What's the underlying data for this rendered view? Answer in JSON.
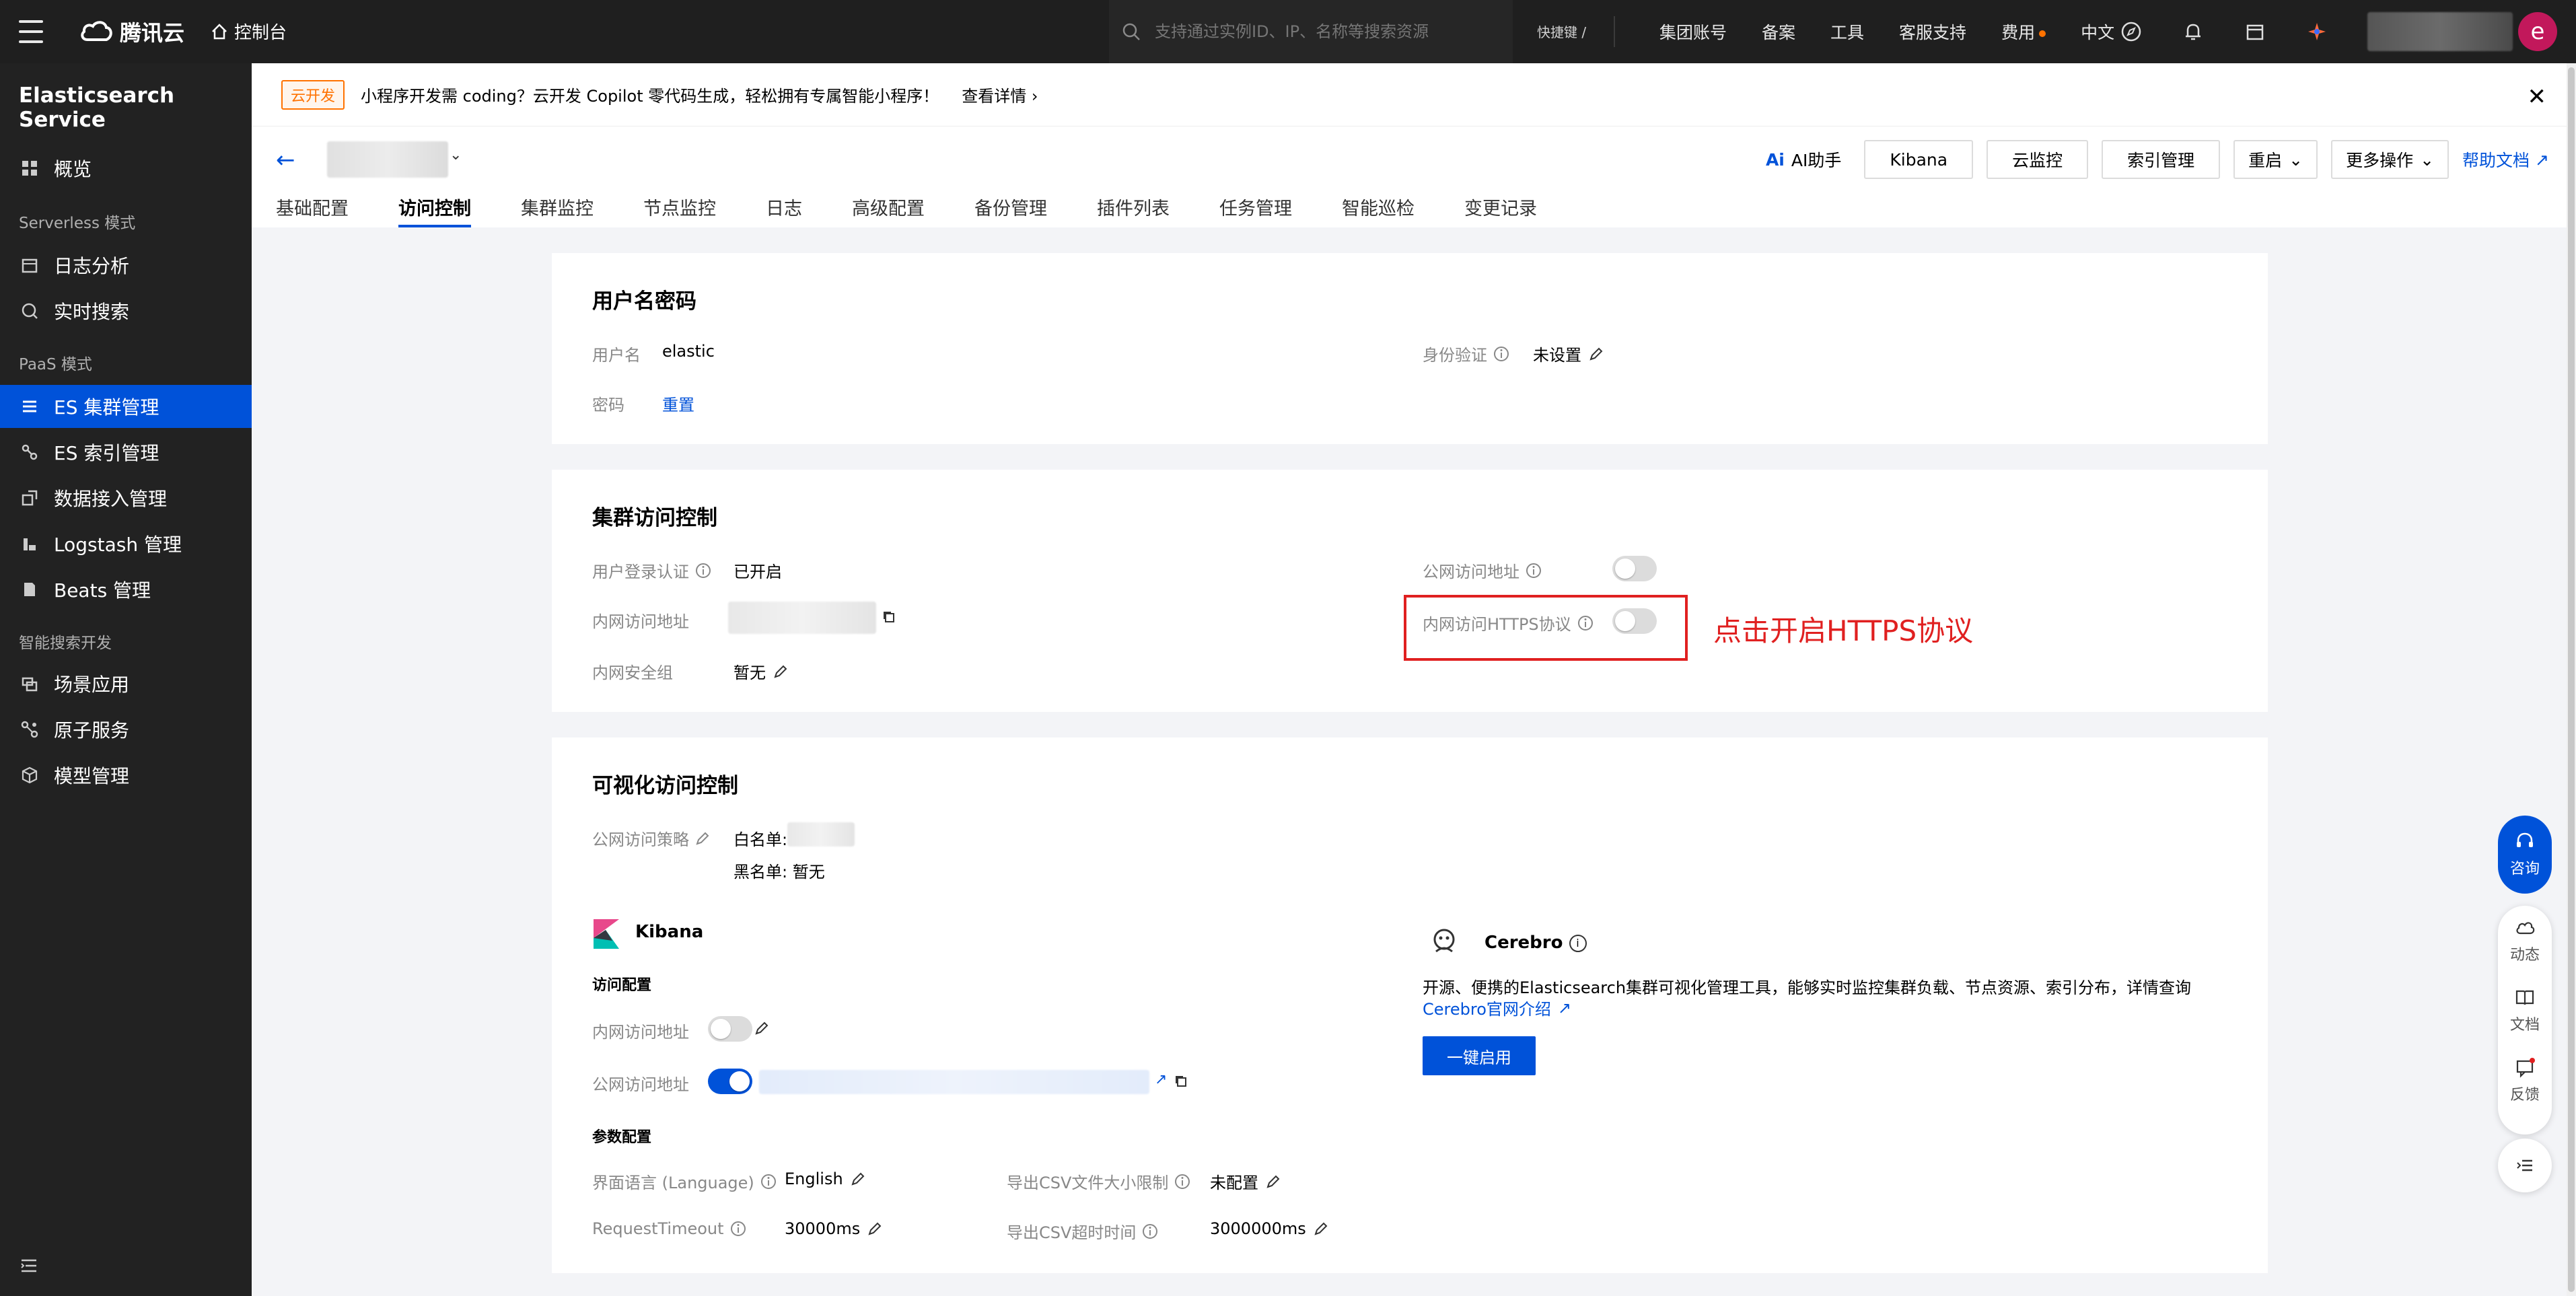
{
  "topbar": {
    "logo_text": "腾讯云",
    "console_label": "控制台",
    "search_placeholder": "支持通过实例ID、IP、名称等搜索资源",
    "shortcut_label": "快捷键 /",
    "nav": [
      "集团账号",
      "备案",
      "工具",
      "客服支持",
      "费用",
      "中文"
    ],
    "avatar_letter": "e"
  },
  "sidebar": {
    "title": "Elasticsearch Service",
    "items": [
      {
        "label": "概览",
        "icon": "grid-icon"
      },
      {
        "group": "Serverless 模式"
      },
      {
        "label": "日志分析",
        "icon": "calendar-icon"
      },
      {
        "label": "实时搜索",
        "icon": "search-doc-icon"
      },
      {
        "group": "PaaS 模式"
      },
      {
        "label": "ES 集群管理",
        "icon": "list-icon",
        "active": true
      },
      {
        "label": "ES 索引管理",
        "icon": "link-icon"
      },
      {
        "label": "数据接入管理",
        "icon": "import-icon"
      },
      {
        "label": "Logstash 管理",
        "icon": "bar-icon"
      },
      {
        "label": "Beats 管理",
        "icon": "doc-icon"
      },
      {
        "group": "智能搜索开发"
      },
      {
        "label": "场景应用",
        "icon": "window-icon"
      },
      {
        "label": "原子服务",
        "icon": "nodes-icon"
      },
      {
        "label": "模型管理",
        "icon": "cube-icon"
      }
    ]
  },
  "banner": {
    "tag": "云开发",
    "text": "小程序开发需 coding？云开发 Copilot 零代码生成，轻松拥有专属智能小程序！",
    "detail": "查看详情"
  },
  "header": {
    "tabs": [
      "基础配置",
      "访问控制",
      "集群监控",
      "节点监控",
      "日志",
      "高级配置",
      "备份管理",
      "插件列表",
      "任务管理",
      "智能巡检",
      "变更记录"
    ],
    "active_tab": 1,
    "ai_label": "AI助手",
    "buttons": [
      "Kibana",
      "云监控",
      "索引管理"
    ],
    "restart_label": "重启",
    "more_label": "更多操作",
    "help_label": "帮助文档"
  },
  "card1": {
    "title": "用户名密码",
    "username_label": "用户名",
    "username_value": "elastic",
    "password_label": "密码",
    "reset_label": "重置",
    "auth_label": "身份验证",
    "auth_value": "未设置"
  },
  "card2": {
    "title": "集群访问控制",
    "login_auth_label": "用户登录认证",
    "login_auth_value": "已开启",
    "intranet_addr_label": "内网访问地址",
    "intranet_sg_label": "内网安全组",
    "intranet_sg_value": "暂无",
    "public_addr_label": "公网访问地址",
    "https_label": "内网访问HTTPS协议",
    "annotation": "点击开启HTTPS协议"
  },
  "card3": {
    "title": "可视化访问控制",
    "policy_label": "公网访问策略",
    "whitelist_label": "白名单:",
    "blacklist_label": "黑名单: 暂无",
    "kibana_title": "Kibana",
    "access_config": "访问配置",
    "intranet_label": "内网访问地址",
    "public_label": "公网访问地址",
    "param_config": "参数配置",
    "lang_label": "界面语言 (Language)",
    "lang_value": "English",
    "timeout_label": "RequestTimeout",
    "timeout_value": "30000ms",
    "csv_size_label": "导出CSV文件大小限制",
    "csv_size_value": "未配置",
    "csv_timeout_label": "导出CSV超时时间",
    "csv_timeout_value": "3000000ms",
    "cerebro_title": "Cerebro",
    "cerebro_desc": "开源、便携的Elasticsearch集群可视化管理工具，能够实时监控集群负载、节点资源、索引分布，详情查询",
    "cerebro_link": "Cerebro官网介绍",
    "enable_button": "一键启用"
  },
  "float": {
    "consult": "咨询",
    "activity": "动态",
    "docs": "文档",
    "feedback": "反馈"
  },
  "colors": {
    "primary": "#0052d9",
    "annotation": "#e02020",
    "sidebar": "#222222"
  }
}
